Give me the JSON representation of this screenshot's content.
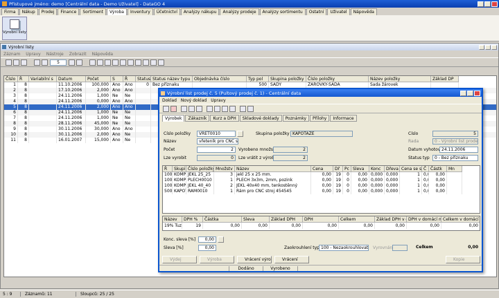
{
  "app": {
    "title": "Přistupové jméno: demo [Centrální data - Demo Uživatel] - DataGO 4"
  },
  "menu_tabs": [
    "Firma",
    "Nákup",
    "Prodej",
    "Finance",
    "Sortiment",
    "Výroba",
    "Inventury",
    "Účetnictví",
    "Analýzy nákupu",
    "Analýzy prodeje",
    "Analýzy sortimentu",
    "Ostatní",
    "Uživatel",
    "Nápověda"
  ],
  "active_tab": "Výroba",
  "ribbon": {
    "button_label": "Výrobní listy"
  },
  "list_window": {
    "title": "Výrobní listy",
    "menu": [
      "Záznam",
      "Úpravy",
      "Nástroje",
      "Zobrazit",
      "Nápověda"
    ],
    "page_number": "5",
    "columns": [
      "Číslo",
      "Ř",
      "Variabilní s",
      "Datum",
      "Počet",
      "S",
      "Ř",
      "Status1",
      "Status název typu",
      "Objednávka číslo",
      "Typ pol",
      "Skupina položky",
      "Číslo položky",
      "Název položky",
      "Základ DP"
    ],
    "rows": [
      [
        "1",
        "8",
        "",
        "11.10.2006",
        "100,000",
        "Ano",
        "Ano",
        "0",
        "Bez příznaku",
        "",
        "500",
        "SADY",
        "ZAROVKY-SADA",
        "Sada žárovek",
        ""
      ],
      [
        "2",
        "8",
        "",
        "17.10.2006",
        "2,000",
        "Ano",
        "Ano",
        "",
        "",
        "",
        "",
        "",
        "",
        "",
        ""
      ],
      [
        "3",
        "8",
        "",
        "24.11.2006",
        "1,000",
        "Ne",
        "Ne",
        "",
        "",
        "",
        "",
        "",
        "",
        "",
        ""
      ],
      [
        "4",
        "8",
        "",
        "24.11.2006",
        "0,000",
        "Ano",
        "Ano",
        "",
        "",
        "",
        "",
        "",
        "",
        "",
        ""
      ],
      [
        "5",
        "8",
        "",
        "24.11.2006",
        "2,000",
        "Ano",
        "Ano",
        "",
        "",
        "",
        "",
        "",
        "",
        "",
        ""
      ],
      [
        "6",
        "8",
        "",
        "24.11.2006",
        "1,000",
        "Ne",
        "Ne",
        "",
        "",
        "",
        "",
        "",
        "",
        "",
        ""
      ],
      [
        "7",
        "8",
        "",
        "24.11.2006",
        "1,000",
        "Ne",
        "Ne",
        "",
        "",
        "",
        "",
        "",
        "",
        "",
        ""
      ],
      [
        "8",
        "8",
        "",
        "28.11.2006",
        "45,000",
        "Ne",
        "Ne",
        "",
        "",
        "",
        "",
        "",
        "",
        "",
        ""
      ],
      [
        "9",
        "8",
        "",
        "30.11.2006",
        "30,000",
        "Ano",
        "Ano",
        "",
        "",
        "",
        "",
        "",
        "",
        "",
        ""
      ],
      [
        "10",
        "8",
        "",
        "30.11.2006",
        "2,000",
        "Ano",
        "Ne",
        "",
        "",
        "",
        "",
        "",
        "",
        "",
        ""
      ],
      [
        "11",
        "8",
        "",
        "16.01.2007",
        "15,000",
        "Ano",
        "Ne",
        "",
        "",
        "",
        "",
        "",
        "",
        "",
        ""
      ]
    ],
    "selected_row": 4
  },
  "status_bar": {
    "position": "5 : 9",
    "records": "Záznamů: 11",
    "columns": "Sloupců: 25 / 25"
  },
  "detail": {
    "title": "Výrobní list prodej č. 5 (Pultový prodej č. 1) - Centrální data",
    "menu": [
      "Doklad",
      "Nový doklad",
      "Úpravy"
    ],
    "tabs": [
      "Výrobek",
      "Zákazník",
      "Kurz a DPH",
      "Skladové doklady",
      "Poznámky",
      "Přílohy",
      "Informace"
    ],
    "active_tab": "Výrobek",
    "labels": {
      "cislo_polozky": "Číslo položky",
      "nazev": "Název",
      "pocet": "Počet",
      "lze_vyrobit": "Lze vyrobit",
      "vyrobeno_mnozstvi": "Vyrobeno množství",
      "lze_vratit": "Lze vrátit z výroby",
      "skupina_polozky": "Skupina položky",
      "cislo": "Číslo",
      "rada": "Řada",
      "datum_vyhotoveni": "Datum vyhotovení",
      "status_typ": "Status typ"
    },
    "values": {
      "cislo_polozky": "VRET0010",
      "nazev": "vřeteník pro CNC stroj atd.",
      "pocet": "2",
      "lze_vyrobit": "0",
      "vyrobeno_mnozstvi": "2",
      "lze_vratit": "2",
      "skupina_polozky": "KAPOTAZE",
      "cislo": "5",
      "rada": "0 - Výrobní list prodej",
      "datum_vyhotoveni": "24.11.2006",
      "status_typ": "0 - Bez příznaku"
    },
    "items_columns": [
      "Ř",
      "Skupi",
      "Číslo položky",
      "Množstv",
      "Název",
      "Cena",
      "Dř",
      "Pc",
      "Sleva",
      "Konc",
      "Dřeva",
      "Cena se s",
      "Č",
      "Částk",
      "Mn"
    ],
    "items": [
      [
        "100",
        "KOMPON",
        "JEKL 25_25",
        "3",
        "jekl 25 x 25 mm.",
        "0,00",
        "19",
        "0",
        "0,00",
        "0,000",
        "0,000",
        "1",
        "0,00",
        "0,00",
        ""
      ],
      [
        "100",
        "KOMPON",
        "PLECH0010",
        "1",
        "PLECH 3x3m, 2mm, pozink",
        "0,00",
        "19",
        "0",
        "0,00",
        "0,000",
        "0,000",
        "1",
        "0,00",
        "0,00",
        ""
      ],
      [
        "100",
        "KOMPON",
        "JEKL 40_40",
        "2",
        "JEKL 40x40 mm, tenkostěnný",
        "0,00",
        "19",
        "0",
        "0,00",
        "0,000",
        "0,000",
        "1",
        "0,00",
        "0,00",
        ""
      ],
      [
        "500",
        "KAPOTAZ",
        "RAM0010",
        "1",
        "Rám pro CNC stroj 454545",
        "0,00",
        "19",
        "0",
        "0,00",
        "0,000",
        "0,000",
        "1",
        "0,00",
        "0,00",
        ""
      ]
    ],
    "vat_columns": [
      "Název",
      "DPH %",
      "Částka",
      "Sleva",
      "Základ DPH",
      "DPH",
      "Celkem",
      "Základ DPH v dor",
      "DPH v domácí m",
      "Celkem v domácí"
    ],
    "vat_row": [
      "19% Tuze",
      "19",
      "0,00",
      "0,00",
      "0,00",
      "0,00",
      "0,00",
      "0,00",
      "0,00",
      "0,00"
    ],
    "konc_sleva_label": "Konc. sleva [%]",
    "konc_sleva_value": "0,00",
    "sleva_label": "Sleva [%]",
    "sleva_value": "0,00",
    "zaokrouhleni_label": "Zaokrouhlení typ.",
    "zaokrouhleni_value": "100 - Nezaokrouhlovat",
    "vyrovnani_label": "Vyrovnání",
    "celkem_label": "Celkem",
    "celkem_value": "0,00",
    "buttons": {
      "vydej": "Výdej",
      "vyroba": "Výroba",
      "vraceni_vyroby": "Vrácení výroby",
      "vraceni": "Vrácení",
      "kopie": "Kopie"
    },
    "status": {
      "dodano": "Dodáno",
      "vyrobeno": "Vyrobeno"
    }
  }
}
